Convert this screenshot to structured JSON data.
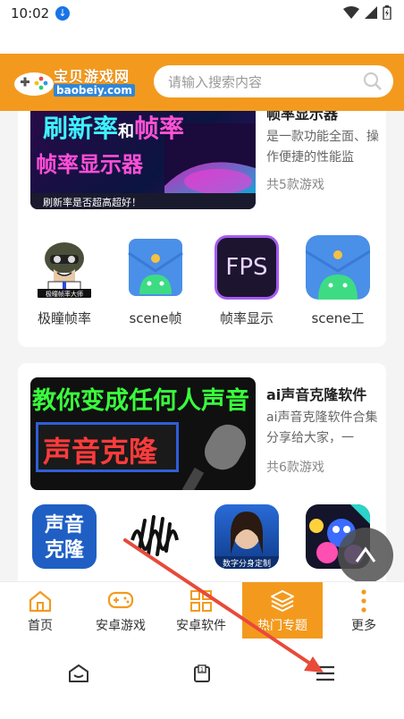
{
  "status": {
    "time": "10:02"
  },
  "header": {
    "logo_text": "宝贝游戏网",
    "logo_url": "baobeiy.com",
    "search_placeholder": "请输入搜索内容"
  },
  "topics": [
    {
      "title": "帧率显示器",
      "desc": "是一款功能全面、操作便捷的性能监",
      "count": "共5款游戏",
      "banner": {
        "line1a": "刷新率",
        "line1b": "和",
        "line1c": "帧率",
        "line2": "帧率显示器",
        "line3": "刷新率是否超高超好！"
      },
      "apps": [
        {
          "label": "极瞳帧率",
          "icon_text": "极瞳帧率大师"
        },
        {
          "label": "scene帧"
        },
        {
          "label": "帧率显示",
          "icon_text": "FPS"
        },
        {
          "label": "scene工"
        }
      ]
    },
    {
      "title": "ai声音克隆软件",
      "desc": "ai声音克隆软件合集分享给大家，一",
      "count": "共6款游戏",
      "banner": {
        "line1a": "教你变成",
        "line1b": "任何人声音",
        "line2": "声音克隆"
      },
      "apps": [
        {
          "label": "",
          "icon_text": "声音克隆"
        },
        {
          "label": ""
        },
        {
          "label": "",
          "icon_text": "数字分身定制"
        },
        {
          "label": ""
        }
      ]
    }
  ],
  "bottom_nav": [
    {
      "label": "首页",
      "icon": "home-icon"
    },
    {
      "label": "安卓游戏",
      "icon": "gamepad-icon"
    },
    {
      "label": "安卓软件",
      "icon": "grid-icon"
    },
    {
      "label": "热门专题",
      "icon": "layers-icon",
      "active": true
    },
    {
      "label": "更多",
      "icon": "more-icon"
    }
  ],
  "colors": {
    "brand": "#f39a1e",
    "accent_blue": "#2f86d8"
  }
}
